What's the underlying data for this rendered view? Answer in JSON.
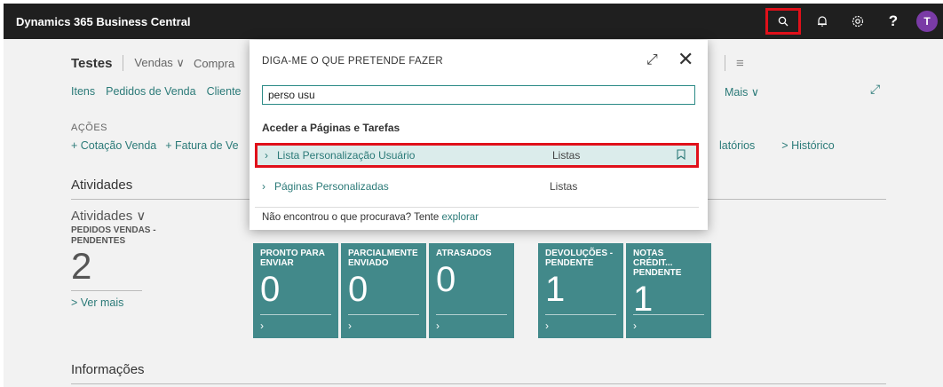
{
  "topbar": {
    "app_title": "Dynamics 365 Business Central",
    "avatar_initial": "T",
    "help_glyph": "?"
  },
  "page": {
    "company": "Testes",
    "row1_links": [
      "Vendas ∨",
      "Compra"
    ],
    "row1_menu_glyph": "≡",
    "row2_links": [
      "Itens",
      "Pedidos de Venda",
      "Cliente"
    ],
    "row2_more": "Mais ∨",
    "acoes_label": "AÇÕES",
    "acoes_links": [
      "+ Cotação Venda",
      "+ Fatura de Ve"
    ],
    "acoes_right": [
      "latórios",
      "> Histórico"
    ],
    "atividades_heading": "Atividades",
    "atividades_sub": "Atividades ∨",
    "cue_label": "PEDIDOS VENDAS - PENDENTES",
    "cue_value": "2",
    "ver_mais": "> Ver mais",
    "tiles": [
      {
        "label": "PRONTO PARA ENVIAR",
        "value": "0"
      },
      {
        "label": "PARCIALMENTE ENVIADO",
        "value": "0"
      },
      {
        "label": "ATRASADOS",
        "value": "0"
      },
      {
        "label": "DEVOLUÇÕES - PENDENTE",
        "value": "1"
      },
      {
        "label": "NOTAS CRÉDIT... PENDENTE",
        "value": "1"
      }
    ],
    "informacoes_heading": "Informações"
  },
  "dialog": {
    "title": "DIGA-ME O QUE PRETENDE FAZER",
    "search_value": "perso usu",
    "section": "Aceder a Páginas e Tarefas",
    "results": [
      {
        "name": "Lista Personalização Usuário",
        "category": "Listas"
      },
      {
        "name": "Páginas Personalizadas",
        "category": "Listas"
      }
    ],
    "footer_text": "Não encontrou o que procurava? Tente ",
    "footer_link": "explorar"
  },
  "colors": {
    "accent": "#2b7a78",
    "tile": "#42898a",
    "highlight": "#e0101a",
    "topbar": "#1f1f1f"
  }
}
